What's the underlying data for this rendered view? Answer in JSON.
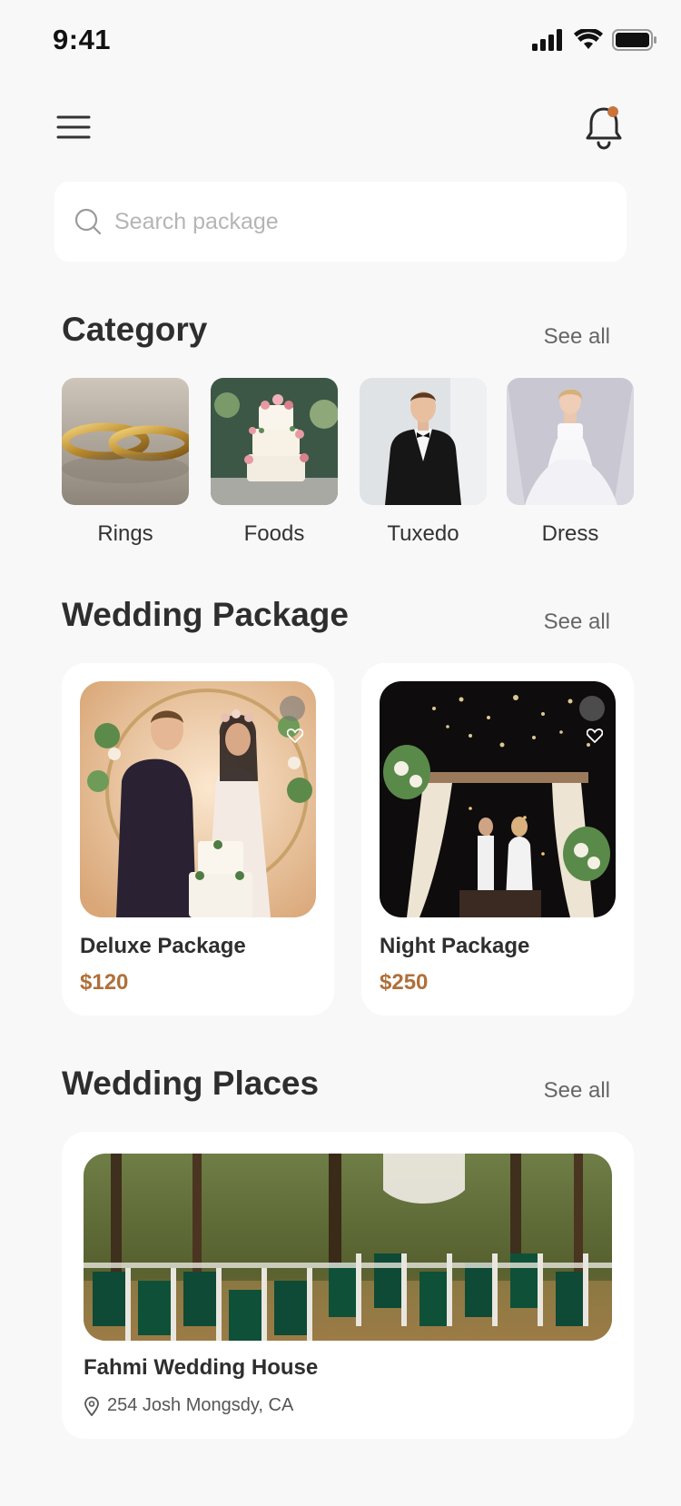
{
  "status_bar": {
    "time": "9:41"
  },
  "search": {
    "placeholder": "Search package",
    "value": ""
  },
  "category": {
    "title": "Category",
    "see_all": "See all",
    "items": [
      {
        "label": "Rings"
      },
      {
        "label": "Foods"
      },
      {
        "label": "Tuxedo"
      },
      {
        "label": "Dress"
      }
    ]
  },
  "wedding_package": {
    "title": "Wedding Package",
    "see_all": "See all",
    "items": [
      {
        "name": "Deluxe Package",
        "price": "$120"
      },
      {
        "name": "Night Package",
        "price": "$250"
      }
    ]
  },
  "wedding_places": {
    "title": "Wedding Places",
    "see_all": "See all",
    "items": [
      {
        "name": "Fahmi Wedding House",
        "address": "254 Josh Mongsdy, CA"
      }
    ]
  },
  "colors": {
    "background": "#f8f8f8",
    "card": "#ffffff",
    "accent_price": "#b0703a",
    "notification_dot": "#c8743b"
  },
  "icons": [
    "menu-icon",
    "bell-icon",
    "search-icon",
    "heart-icon",
    "location-pin-icon",
    "signal-icon",
    "wifi-icon",
    "battery-icon"
  ]
}
